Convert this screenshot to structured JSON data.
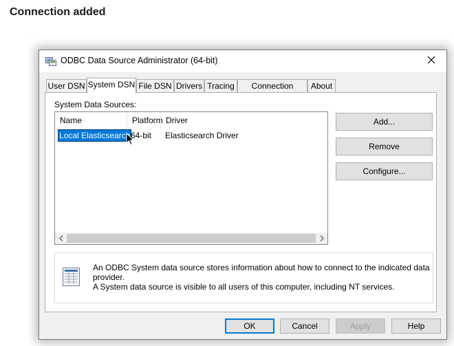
{
  "page": {
    "heading": "Connection added"
  },
  "window": {
    "title": "ODBC Data Source Administrator (64-bit)",
    "app_icon": "odbc-admin-icon",
    "close_icon": "close-icon"
  },
  "tabs": [
    {
      "label": "User DSN",
      "active": false
    },
    {
      "label": "System DSN",
      "active": true
    },
    {
      "label": "File DSN",
      "active": false
    },
    {
      "label": "Drivers",
      "active": false
    },
    {
      "label": "Tracing",
      "active": false
    },
    {
      "label": "Connection Pooling",
      "active": false
    },
    {
      "label": "About",
      "active": false
    }
  ],
  "system_dsn": {
    "group_label": "System Data Sources:",
    "columns": [
      "Name",
      "Platform",
      "Driver"
    ],
    "rows": [
      {
        "name": "Local Elasticsearch",
        "platform": "64-bit",
        "driver": "Elasticsearch Driver",
        "selected": true
      }
    ],
    "buttons": {
      "add": "Add...",
      "remove": "Remove",
      "configure": "Configure..."
    },
    "info_line1": "An ODBC System data source stores information about how to connect to the indicated data provider.",
    "info_line2": "A System data source is visible to all users of this computer, including NT services."
  },
  "footer": {
    "ok": "OK",
    "cancel": "Cancel",
    "apply": "Apply",
    "help": "Help"
  },
  "colors": {
    "selection": "#0078d7",
    "default_button_border": "#0078d7",
    "window_bg": "#f0f0f0"
  }
}
